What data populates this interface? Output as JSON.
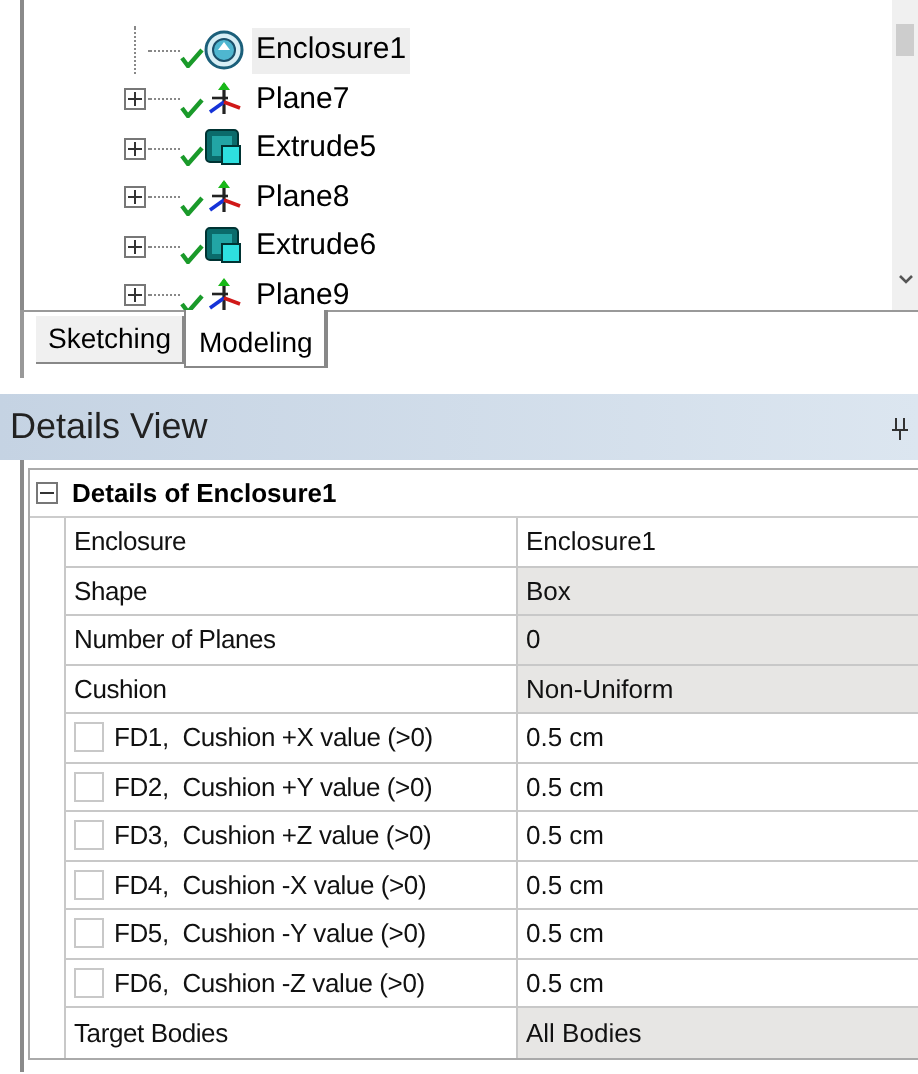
{
  "tree": {
    "items": [
      {
        "label": "Enclosure1",
        "kind": "enclosure",
        "expandable": false,
        "selected": true
      },
      {
        "label": "Plane7",
        "kind": "plane",
        "expandable": true,
        "selected": false
      },
      {
        "label": "Extrude5",
        "kind": "extrude",
        "expandable": true,
        "selected": false
      },
      {
        "label": "Plane8",
        "kind": "plane",
        "expandable": true,
        "selected": false
      },
      {
        "label": "Extrude6",
        "kind": "extrude",
        "expandable": true,
        "selected": false
      },
      {
        "label": "Plane9",
        "kind": "plane",
        "expandable": true,
        "selected": false
      }
    ]
  },
  "tabs": [
    {
      "label": "Sketching",
      "selected": false
    },
    {
      "label": "Modeling",
      "selected": true
    }
  ],
  "details": {
    "title": "Details View",
    "group": {
      "label": "Details of Enclosure1",
      "expanded": true
    },
    "rows": [
      {
        "kind": "plain",
        "name": "Enclosure",
        "value": "Enclosure1",
        "readonly": false
      },
      {
        "kind": "plain",
        "name": "Shape",
        "value": "Box",
        "readonly": true
      },
      {
        "kind": "plain",
        "name": "Number of Planes",
        "value": "0",
        "readonly": true
      },
      {
        "kind": "plain",
        "name": "Cushion",
        "value": "Non-Uniform",
        "readonly": true
      },
      {
        "kind": "parameter",
        "name": "FD1,  Cushion +X value (>0)",
        "value": "0.5 cm",
        "checked": false,
        "readonly": false
      },
      {
        "kind": "parameter",
        "name": "FD2,  Cushion +Y value (>0)",
        "value": "0.5 cm",
        "checked": false,
        "readonly": false
      },
      {
        "kind": "parameter",
        "name": "FD3,  Cushion +Z value (>0)",
        "value": "0.5 cm",
        "checked": false,
        "readonly": false
      },
      {
        "kind": "parameter",
        "name": "FD4,  Cushion -X value (>0)",
        "value": "0.5 cm",
        "checked": false,
        "readonly": false
      },
      {
        "kind": "parameter",
        "name": "FD5,  Cushion -Y value (>0)",
        "value": "0.5 cm",
        "checked": false,
        "readonly": false
      },
      {
        "kind": "parameter",
        "name": "FD6,  Cushion -Z value (>0)",
        "value": "0.5 cm",
        "checked": false,
        "readonly": false
      },
      {
        "kind": "plain",
        "name": "Target Bodies",
        "value": "All Bodies",
        "readonly": true
      }
    ]
  }
}
